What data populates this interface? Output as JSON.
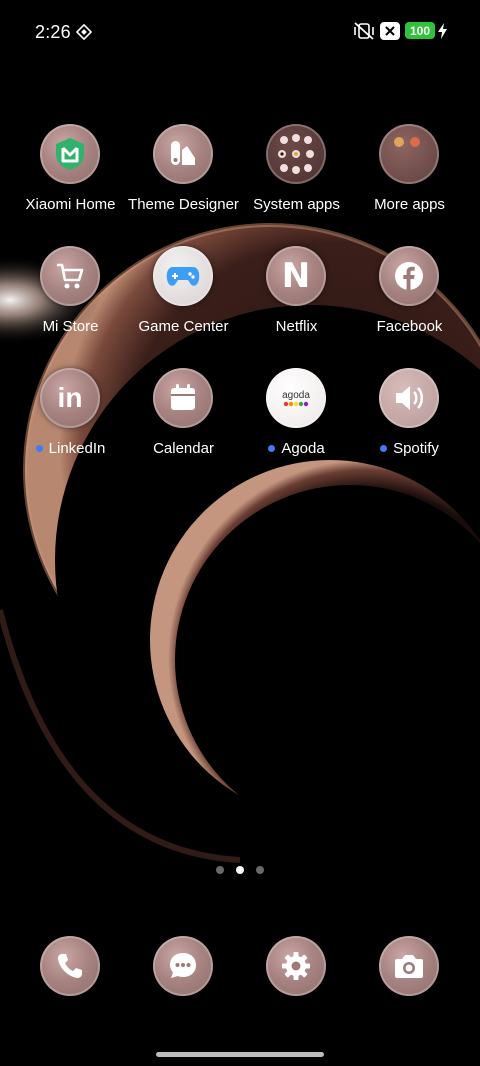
{
  "status_bar": {
    "time": "2:26",
    "battery_level": "100",
    "icons": [
      "signal-diamond-icon",
      "mute-vibrate-icon",
      "close-box-icon",
      "charging-icon"
    ]
  },
  "apps": [
    {
      "label": "Xiaomi Home",
      "icon": "xiaomi-home-icon",
      "new": false
    },
    {
      "label": "Theme Designer",
      "icon": "theme-designer-icon",
      "new": false
    },
    {
      "label": "System apps",
      "icon": "folder-icon",
      "new": false
    },
    {
      "label": "More apps",
      "icon": "folder-icon",
      "new": false
    },
    {
      "label": "Mi Store",
      "icon": "cart-icon",
      "new": false
    },
    {
      "label": "Game Center",
      "icon": "gamepad-icon",
      "new": false
    },
    {
      "label": "Netflix",
      "icon": "netflix-icon",
      "new": false
    },
    {
      "label": "Facebook",
      "icon": "facebook-icon",
      "new": false
    },
    {
      "label": "LinkedIn",
      "icon": "linkedin-icon",
      "new": true
    },
    {
      "label": "Calendar",
      "icon": "calendar-icon",
      "new": false
    },
    {
      "label": "Agoda",
      "icon": "agoda-icon",
      "new": true
    },
    {
      "label": "Spotify",
      "icon": "speaker-icon",
      "new": true
    }
  ],
  "agoda_wordmark": "agoda",
  "netflix_glyph": "N",
  "linkedin_glyph": "in",
  "pager": {
    "pages": 3,
    "active": 2
  },
  "dock": [
    "phone-icon",
    "messages-icon",
    "settings-icon",
    "camera-icon"
  ],
  "colors": {
    "new_dot": "#3f7cf3",
    "battery": "#2fc33c",
    "icon_bg": "#a78482"
  }
}
